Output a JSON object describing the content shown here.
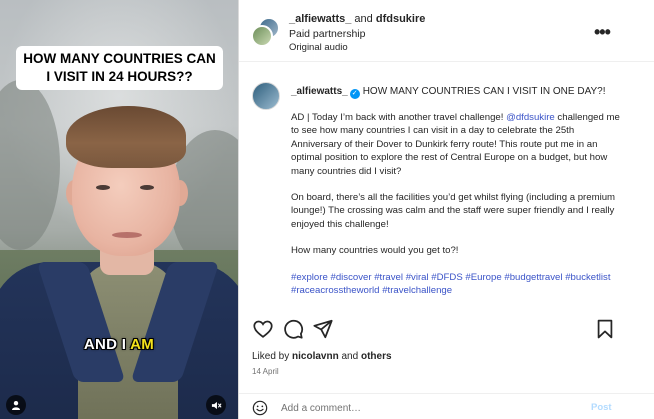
{
  "video": {
    "headline": "HOW MANY COUNTRIES CAN I VISIT IN 24 HOURS??",
    "caption_plain": "AND I ",
    "caption_highlight": "AM"
  },
  "header": {
    "user1": "_alfiewatts_",
    "and": " and ",
    "user2": "dfdsukire",
    "paid": "Paid partnership",
    "audio": "Original audio",
    "more": "•••"
  },
  "post": {
    "author": "_alfiewatts_",
    "title": "HOW MANY COUNTRIES CAN I VISIT IN ONE DAY?!",
    "p1_a": "AD | Today I’m back with another travel challenge! ",
    "p1_mention": "@dfdsukire",
    "p1_b": " challenged me to see how many countries I can visit in a day to celebrate the 25th Anniversary of their Dover to Dunkirk ferry route! This route put me in an optimal position to explore the rest of Central Europe on a budget, but how many countries did I visit?",
    "p2": "On board, there’s all the facilities you’d get whilst flying (including a premium lounge!) The crossing was calm and the staff were super friendly and I really enjoyed this challenge!",
    "p3": "How many countries would you get to?!",
    "hashtags": [
      "#explore",
      "#discover",
      "#travel",
      "#viral",
      "#DFDS",
      "#Europe",
      "#budgettravel",
      "#bucketlist",
      "#raceacrosstheworld",
      "#travelchallenge"
    ]
  },
  "likes": {
    "prefix": "Liked by ",
    "user": "nicolavnn",
    "mid": " and ",
    "others": "others"
  },
  "date": "14 April",
  "comment": {
    "placeholder": "Add a comment…",
    "post_label": "Post"
  },
  "icons": {
    "like": "heart-icon",
    "comment": "comment-icon",
    "share": "send-icon",
    "save": "bookmark-icon",
    "emoji": "emoji-icon",
    "user": "user-icon",
    "mute": "mute-icon",
    "verified": "verified-badge-icon"
  },
  "colors": {
    "link": "#3b54c8",
    "verified": "#0095f6",
    "caption_highlight": "#f4e21b",
    "post_button": "#b3dbff"
  }
}
